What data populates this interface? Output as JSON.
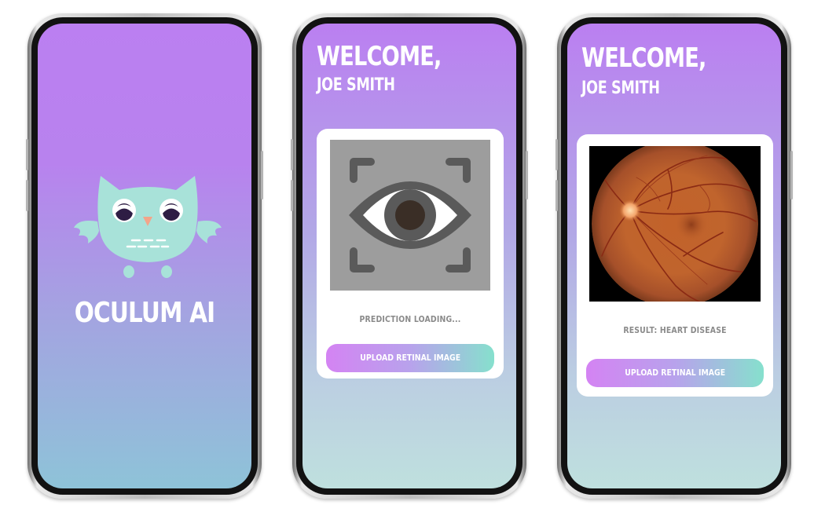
{
  "splash": {
    "app_name": "OCULUM AI"
  },
  "loading_screen": {
    "welcome": "WELCOME,",
    "user_name": "JOE SMITH",
    "status": "PREDICTION LOADING...",
    "upload_label": "UPLOAD RETINAL IMAGE",
    "placeholder_icon": "eye-scan-icon"
  },
  "result_screen": {
    "welcome": "WELCOME,",
    "user_name": "JOE SMITH",
    "status": "RESULT: HEART DISEASE",
    "upload_label": "UPLOAD RETINAL IMAGE"
  },
  "colors": {
    "gradient_top": "#bb7ff1",
    "gradient_bottom_splash": "#8ec3d8",
    "gradient_bottom_app": "#bfe0de",
    "button_start": "#d483f3",
    "button_end": "#86e0cd",
    "owl_body": "#a8e2d9",
    "status_text": "#8a8a8a"
  },
  "icons": [
    "owl-logo-icon",
    "eye-scan-icon",
    "retina-fundus-image"
  ]
}
